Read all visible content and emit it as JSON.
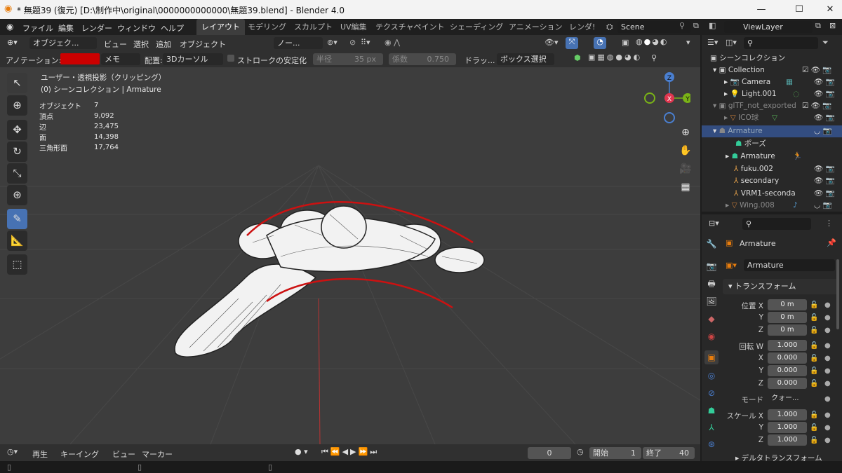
{
  "window": {
    "title": "* 無題39 (復元) [D:\\制作中\\original\\0000000000000\\無題39.blend] - Blender 4.0"
  },
  "menu": {
    "file": "ファイル",
    "edit": "編集",
    "render": "レンダー",
    "window": "ウィンドウ",
    "help": "ヘルプ"
  },
  "workspaces": [
    "レイアウト",
    "モデリング",
    "スカルプト",
    "UV編集",
    "テクスチャペイント",
    "シェーディング",
    "アニメーション",
    "レンダ!"
  ],
  "scene": {
    "name": "Scene",
    "view_layer": "ViewLayer"
  },
  "viewport_header": {
    "mode": "オブジェク...",
    "view": "ビュー",
    "select": "選択",
    "add": "追加",
    "object": "オブジェクト",
    "pivot": "ノー..."
  },
  "tool_header": {
    "annotation_label": "アノテーション:",
    "annotation_color": "#cc0000",
    "placement_type": "メモ",
    "placement_label": "配置:",
    "placement_value": "3Dカーソル",
    "stabilize": "ストロークの安定化",
    "radius_label": "半径",
    "radius_value": "35 px",
    "factor_label": "係数",
    "factor_value": "0.750",
    "drag_label": "ドラッ...",
    "drag_value": "ボックス選択"
  },
  "viewport": {
    "view_name": "ユーザー・透視投影（クリッピング）",
    "collection_line": "(0) シーンコレクション | Armature",
    "stats": [
      {
        "label": "オブジェクト",
        "value": "7"
      },
      {
        "label": "頂点",
        "value": "9,092"
      },
      {
        "label": "辺",
        "value": "23,475"
      },
      {
        "label": "面",
        "value": "14,398"
      },
      {
        "label": "三角形面",
        "value": "17,764"
      }
    ],
    "gizmo": {
      "z": "Z",
      "x": "X",
      "y": "Y"
    }
  },
  "timeline": {
    "playback": "再生",
    "keying": "キーイング",
    "view": "ビュー",
    "marker": "マーカー",
    "current_frame": "0",
    "start_label": "開始",
    "start": "1",
    "end_label": "終了",
    "end": "40"
  },
  "outliner": {
    "root": "シーンコレクション",
    "rows": [
      {
        "name": "Collection"
      },
      {
        "name": "Camera"
      },
      {
        "name": "Light.001"
      },
      {
        "name": "glTF_not_exported"
      },
      {
        "name": "ICO球"
      },
      {
        "name": "Armature"
      },
      {
        "name": "ポーズ"
      },
      {
        "name": "Armature"
      },
      {
        "name": "fuku.002"
      },
      {
        "name": "secondary"
      },
      {
        "name": "VRM1-seconda"
      },
      {
        "name": "Wing.008"
      }
    ]
  },
  "properties": {
    "object_name": "Armature",
    "data_name": "Armature",
    "section": "トランスフォーム",
    "location_label": "位置 X",
    "location": [
      "0 m",
      "0 m",
      "0 m"
    ],
    "rotation_label": "回転 W",
    "rotation": [
      "1.000",
      "0.000",
      "0.000",
      "0.000"
    ],
    "mode_label": "モード",
    "mode_value": "クォー...",
    "scale_label": "スケール X",
    "scale": [
      "1.000",
      "1.000",
      "1.000"
    ],
    "delta": "デルタトランスフォーム",
    "axes": {
      "x": "X",
      "y": "Y",
      "z": "Z"
    }
  },
  "colors": {
    "accent": "#4772b3",
    "selection": "#334d80",
    "annotation": "#cc0000"
  }
}
